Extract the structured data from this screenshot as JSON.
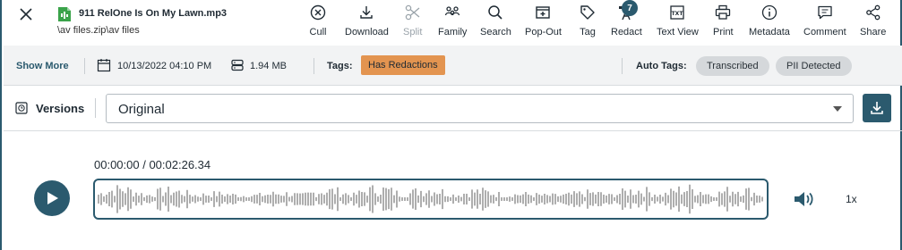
{
  "header": {
    "file_title": "911 RelOne Is On My Lawn.mp3",
    "file_path": "\\av files.zip\\av files"
  },
  "toolbar": {
    "items": [
      {
        "label": "Cull",
        "icon": "cull-icon"
      },
      {
        "label": "Download",
        "icon": "download-icon"
      },
      {
        "label": "Split",
        "icon": "scissors-icon",
        "disabled": true
      },
      {
        "label": "Family",
        "icon": "family-icon"
      },
      {
        "label": "Search",
        "icon": "search-icon"
      },
      {
        "label": "Pop-Out",
        "icon": "pop-out-icon"
      },
      {
        "label": "Tag",
        "icon": "tag-icon"
      },
      {
        "label": "Redact",
        "icon": "redact-icon",
        "badge": "7"
      },
      {
        "label": "Text View",
        "icon": "text-view-icon"
      },
      {
        "label": "Print",
        "icon": "print-icon"
      },
      {
        "label": "Metadata",
        "icon": "info-icon"
      },
      {
        "label": "Comment",
        "icon": "comment-icon"
      },
      {
        "label": "Share",
        "icon": "share-icon"
      }
    ]
  },
  "infobar": {
    "show_more": "Show More",
    "date": "10/13/2022 04:10 PM",
    "size": "1.94 MB",
    "tags_label": "Tags:",
    "tags": [
      "Has Redactions"
    ],
    "auto_tags_label": "Auto Tags:",
    "auto_tags": [
      "Transcribed",
      "PII Detected"
    ]
  },
  "versions": {
    "label": "Versions",
    "selected": "Original"
  },
  "player": {
    "time": "00:00:00 / 00:02:26.34",
    "speed": "1x"
  },
  "colors": {
    "accent": "#2b5a6e",
    "tag_orange": "#e39450",
    "pill_gray": "#d5d8db",
    "waveform": "#9a9a9a"
  }
}
